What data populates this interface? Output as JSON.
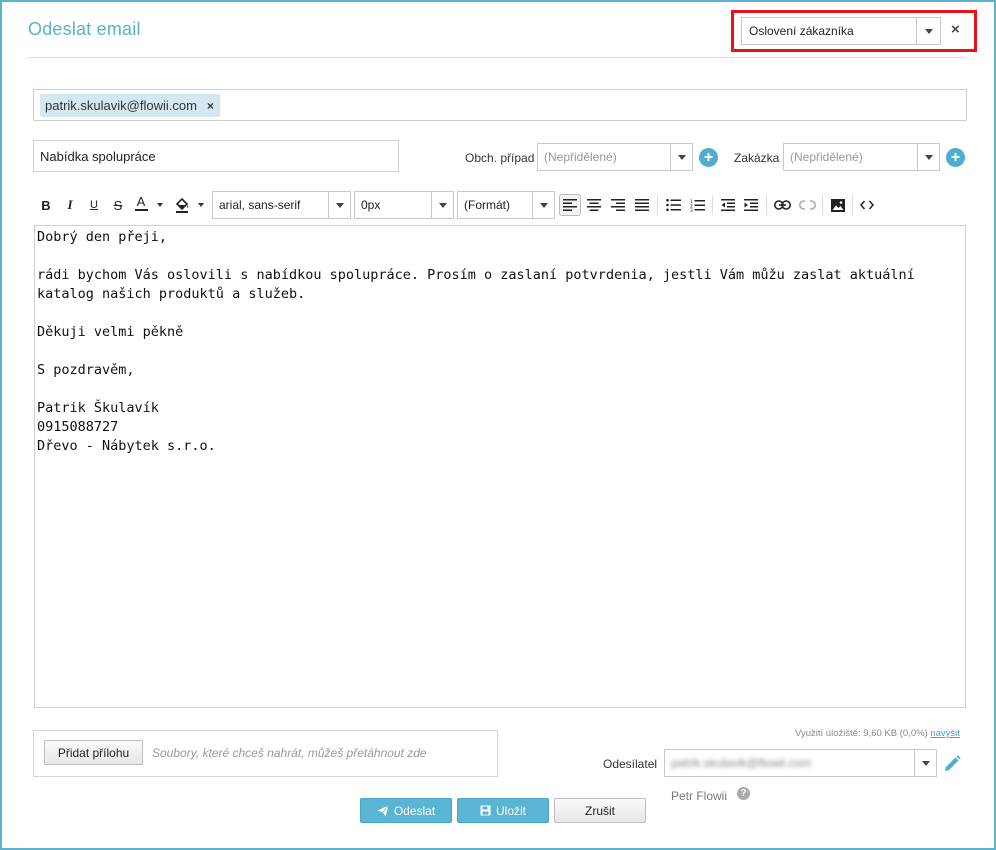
{
  "header": {
    "title": "Odeslat email",
    "template_select": {
      "value": "Oslovení zákazníka",
      "icon": "chevron-down-icon"
    },
    "close_label": "×",
    "highlight_color": "#e3141a"
  },
  "recipients": [
    {
      "email": "patrik.skulavik@flowii.com",
      "remove": "×"
    }
  ],
  "subject": {
    "value": "Nabídka spolupráce"
  },
  "obch_pripad": {
    "label": "Obch. případ",
    "placeholder": "(Nepřidělené)"
  },
  "zakazka": {
    "label": "Zakázka",
    "placeholder": "(Nepřidělené)"
  },
  "toolbar": {
    "bold": "B",
    "italic": "I",
    "underline": "U",
    "strike": "S",
    "font_color": "A",
    "font_family": "arial, sans-serif",
    "font_size": "0px",
    "format": "(Formát)"
  },
  "body": {
    "greeting": "Dobrý den přeji,",
    "paragraph": "rádi bychom Vás oslovili s nabídkou spolupráce. Prosím o zaslaní potvrdenia, jestli Vám můžu zaslat aktuální katalog našich produktů a služeb.",
    "thanks": "Děkuji velmi pěkně",
    "closing": "S pozdravěm,",
    "sig_name": "Patrik Škulavík",
    "sig_phone": "0915088727",
    "sig_company": "Dřevo - Nábytek s.r.o."
  },
  "storage": {
    "text": "Využití úložiště: 9,60 KB (0,0%)",
    "link": "navýšit"
  },
  "attachments": {
    "button": "Přidat přílohu",
    "hint": "Soubory, které chceš nahrát, můžeš přetáhnout zde"
  },
  "sender": {
    "label": "Odesílatel",
    "value": "patrik.skulavik@flowii.com",
    "name": "Petr Flowii",
    "help": "?"
  },
  "actions": {
    "send": "Odeslat",
    "save": "Uložit",
    "cancel": "Zrušit"
  },
  "colors": {
    "accent": "#5ab4d4",
    "frame": "#5bb3cf"
  }
}
